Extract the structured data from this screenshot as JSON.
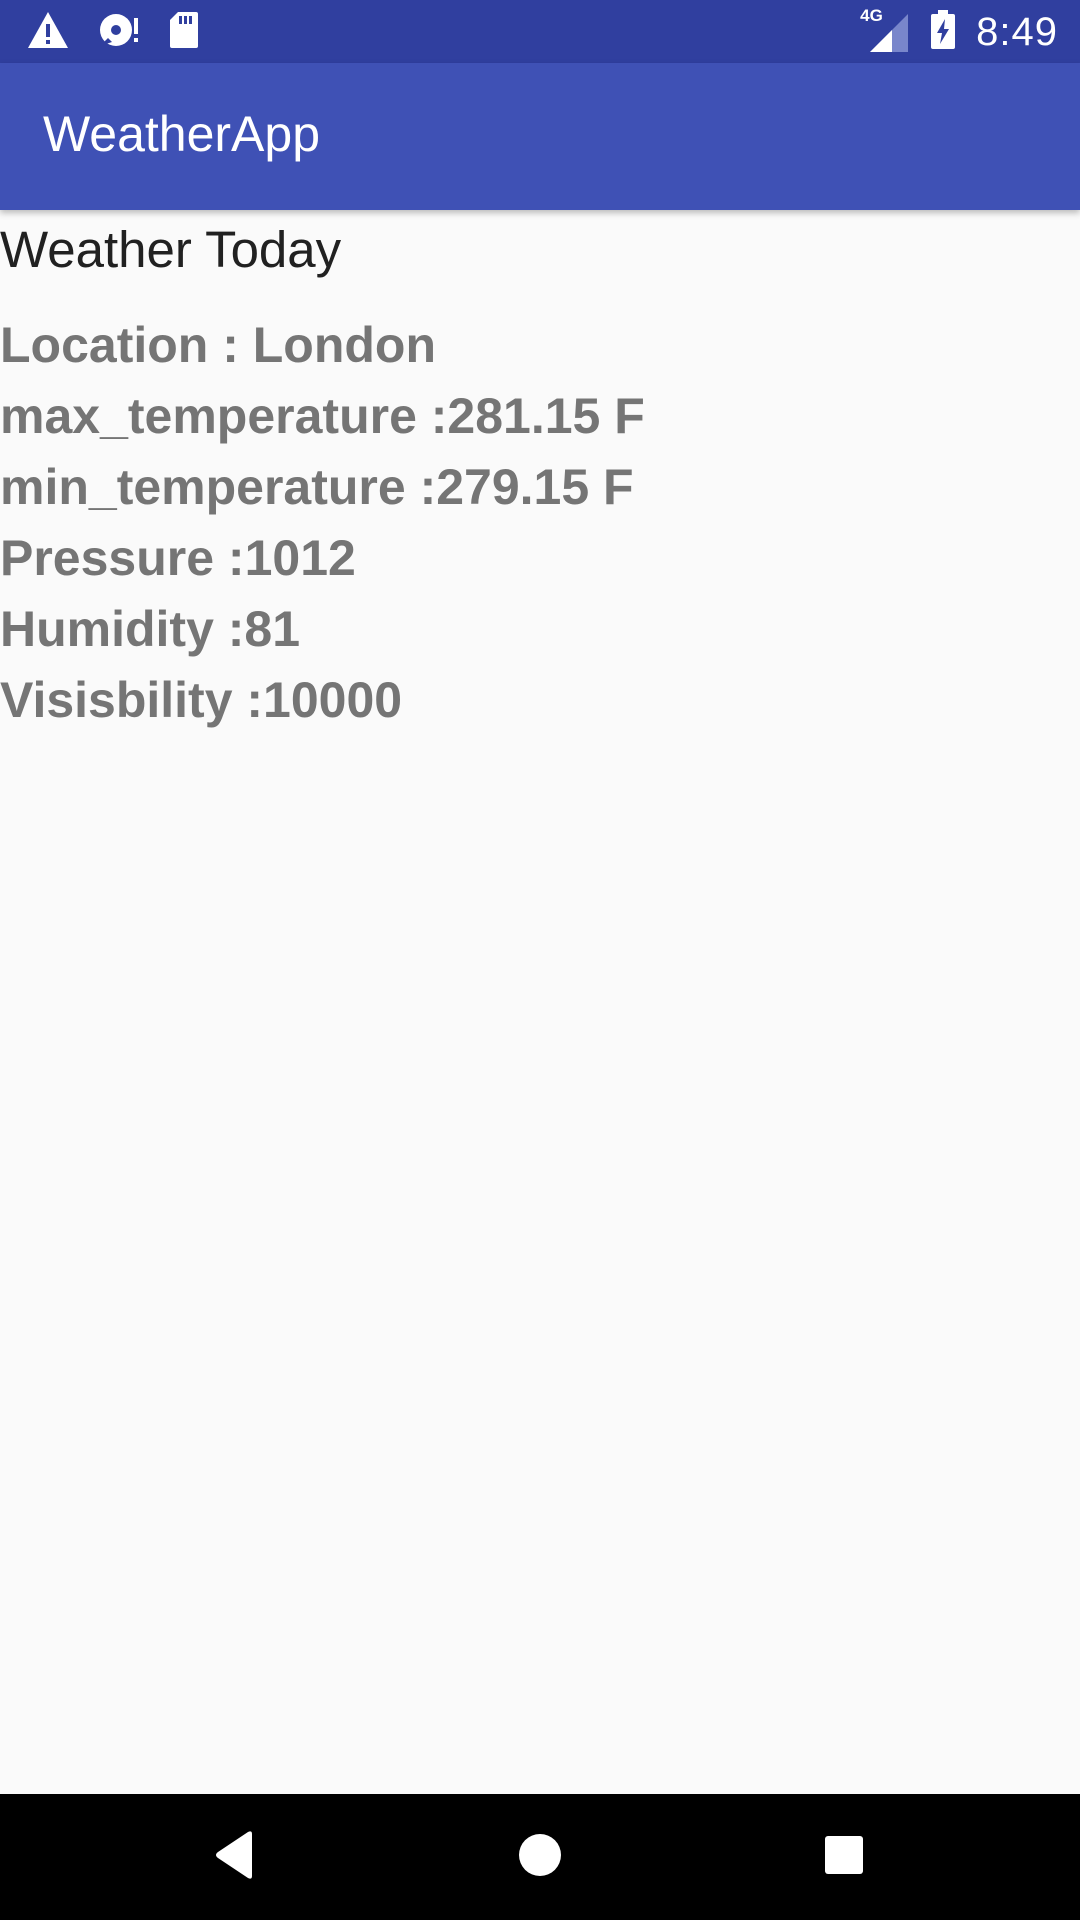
{
  "status_bar": {
    "icons_left": [
      "warning-icon",
      "disc-alert-icon",
      "sd-card-icon"
    ],
    "network_label": "4G",
    "icons_right": [
      "cell-signal-icon",
      "battery-charging-icon"
    ],
    "time": "8:49"
  },
  "app_bar": {
    "title": "WeatherApp",
    "color": "#3f51b5",
    "status_color": "#303f9f"
  },
  "main": {
    "heading": "Weather Today",
    "lines": [
      "Location : London",
      "max_temperature :281.15 F",
      "min_temperature :279.15 F",
      "Pressure :1012",
      "Humidity :81",
      "Visisbility :10000"
    ],
    "text_color": "#757575"
  },
  "nav_bar": {
    "buttons": [
      "back-icon",
      "home-icon",
      "recents-icon"
    ]
  }
}
